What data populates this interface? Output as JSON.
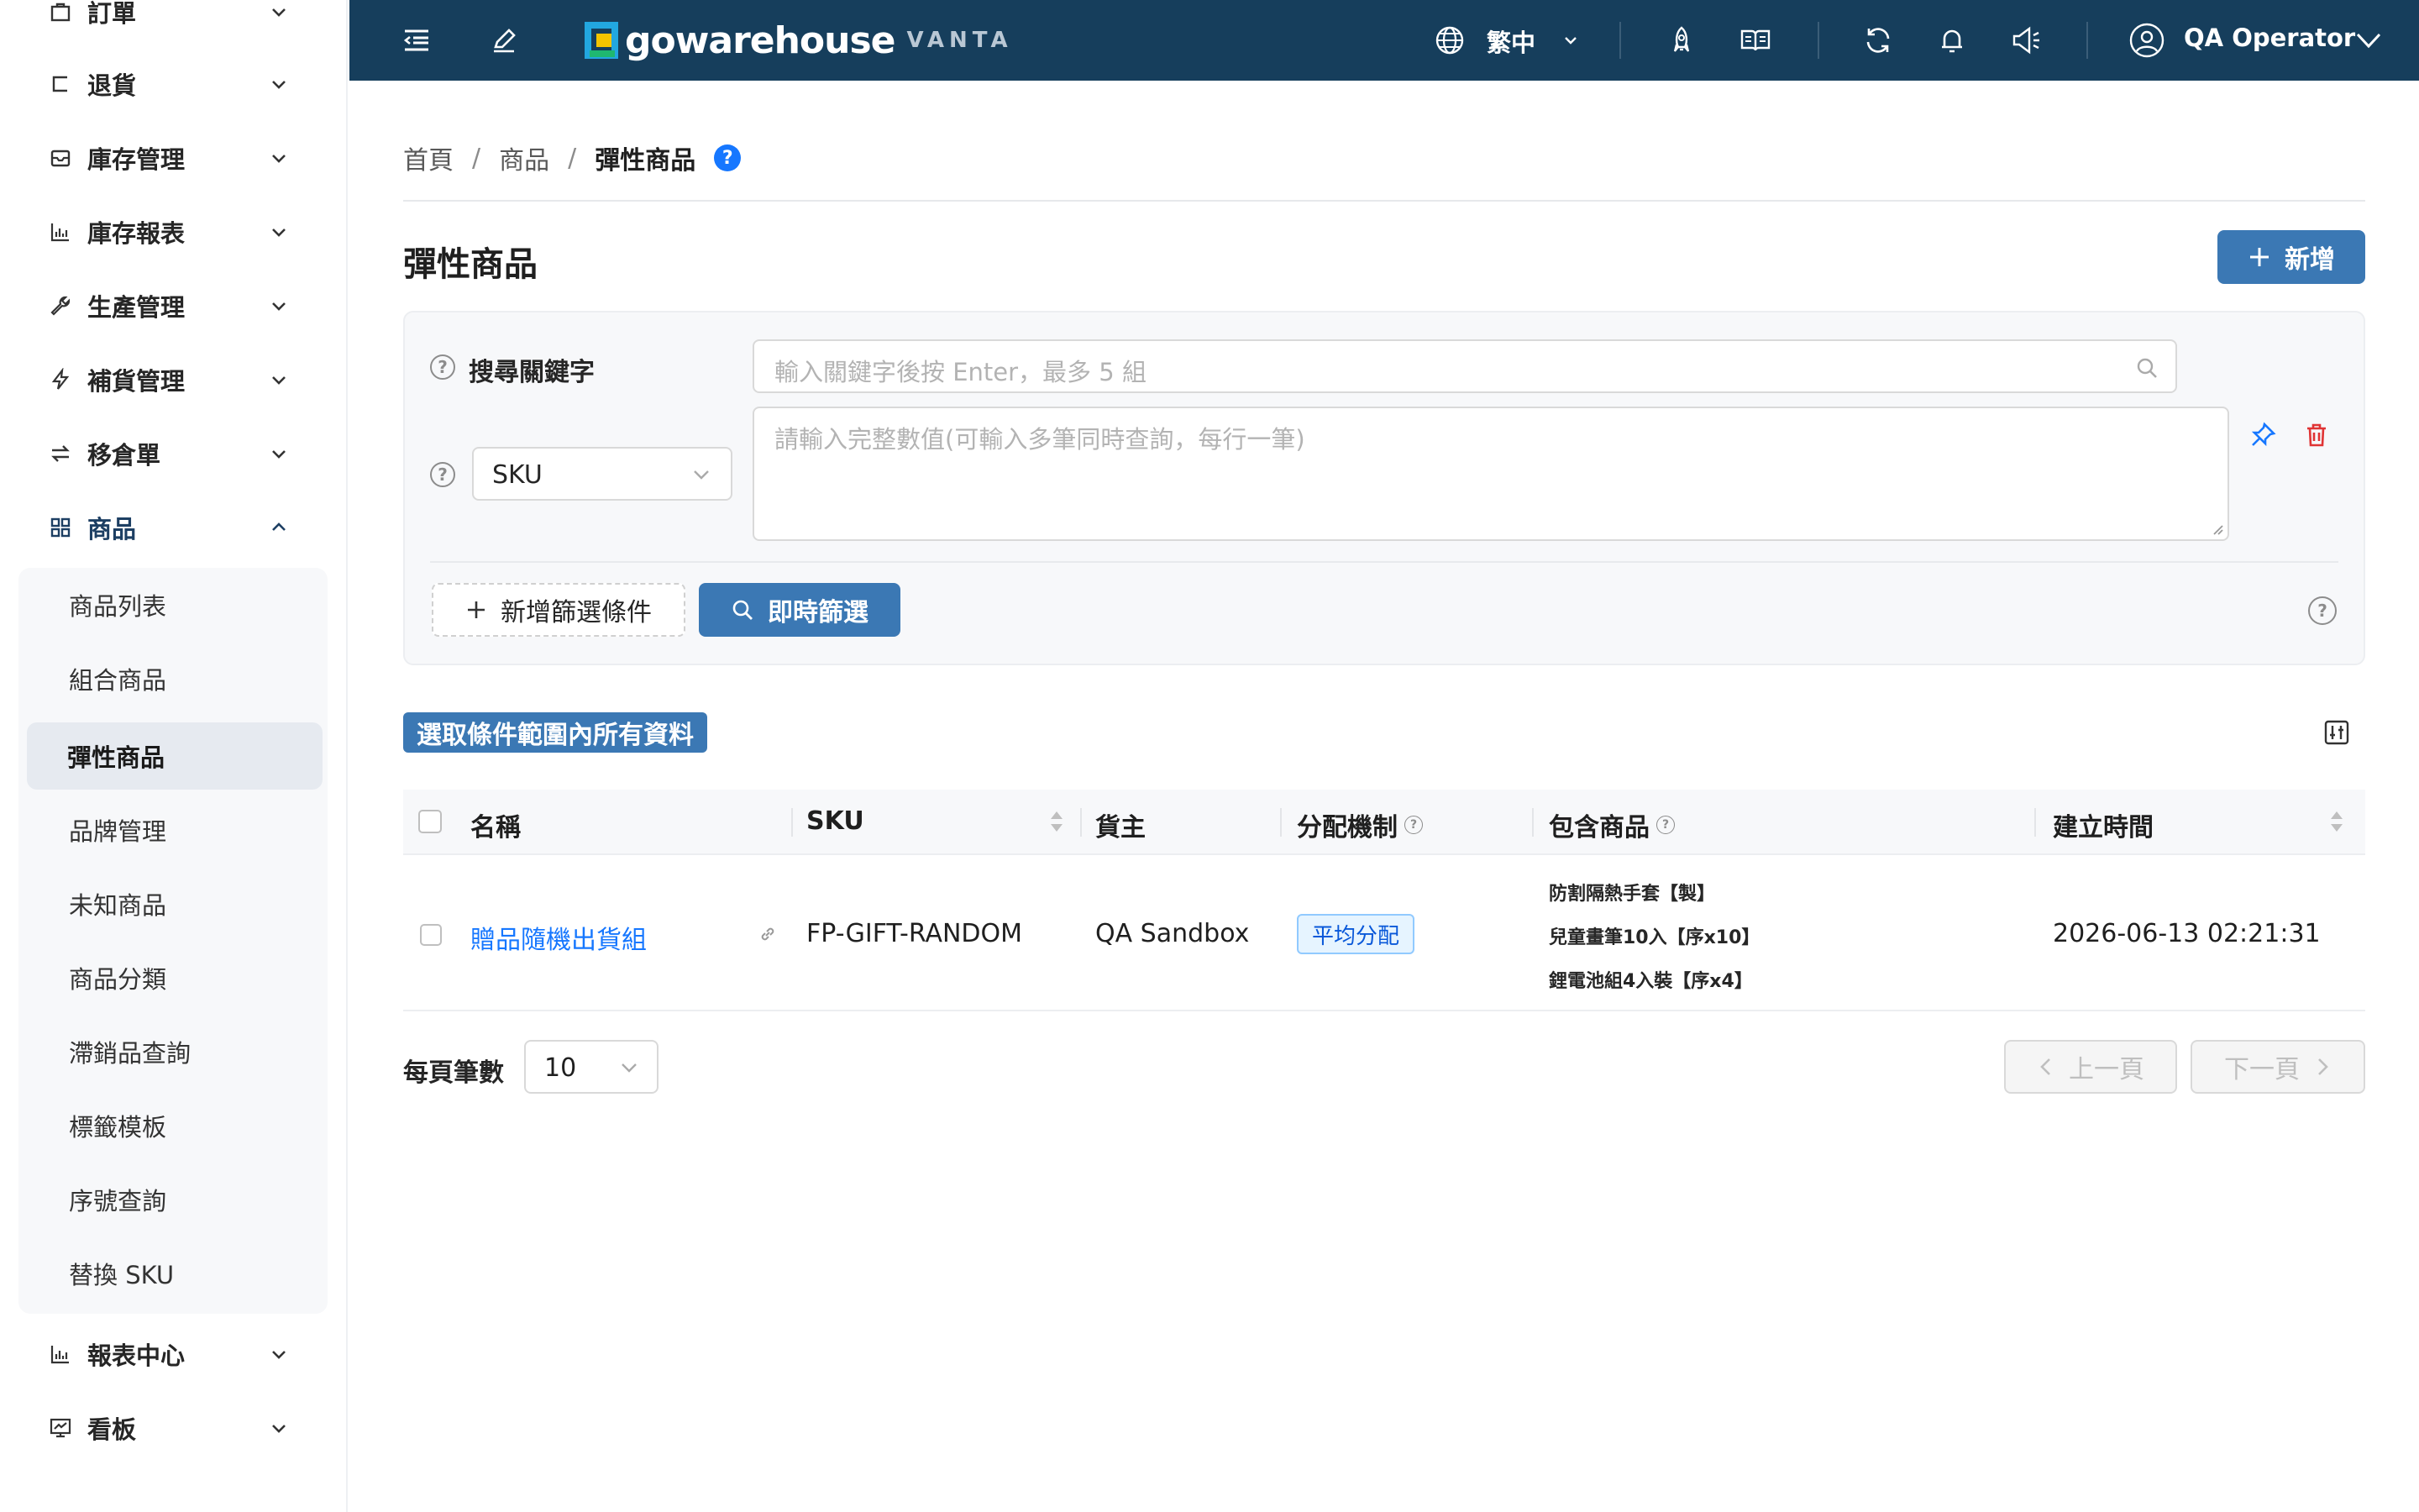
{
  "sidebar": {
    "items": [
      {
        "label": "訂單",
        "icon": "bag-icon"
      },
      {
        "label": "退貨",
        "icon": "return-icon"
      },
      {
        "label": "庫存管理",
        "icon": "inbox-icon"
      },
      {
        "label": "庫存報表",
        "icon": "bar-chart-icon"
      },
      {
        "label": "生產管理",
        "icon": "tool-icon"
      },
      {
        "label": "補貨管理",
        "icon": "thunder-icon"
      },
      {
        "label": "移倉單",
        "icon": "swap-icon"
      },
      {
        "label": "商品",
        "icon": "grid-icon"
      },
      {
        "label": "報表中心",
        "icon": "bar-chart-icon"
      },
      {
        "label": "看板",
        "icon": "dashboard-icon"
      }
    ],
    "submenu": [
      "商品列表",
      "組合商品",
      "彈性商品",
      "品牌管理",
      "未知商品",
      "商品分類",
      "滯銷品查詢",
      "標籤模板",
      "序號查詢",
      "替換 SKU"
    ],
    "selected_submenu": "彈性商品"
  },
  "topbar": {
    "logo_text": "gowarehouse",
    "logo_sub": "VANTA",
    "language": "繁中",
    "user": "QA Operator"
  },
  "breadcrumb": [
    "首頁",
    "商品",
    "彈性商品"
  ],
  "page": {
    "title": "彈性商品",
    "add_button": "新增"
  },
  "filter": {
    "keyword_label": "搜尋關鍵字",
    "keyword_placeholder": "輸入關鍵字後按 Enter，最多 5 組",
    "field_select": "SKU",
    "values_placeholder": "請輸入完整數值(可輸入多筆同時查詢，每行一筆)",
    "add_filter_button": "新增篩選條件",
    "search_button": "即時篩選"
  },
  "select_all_tag": "選取條件範圍內所有資料",
  "table": {
    "columns": [
      "名稱",
      "SKU",
      "貨主",
      "分配機制",
      "包含商品",
      "建立時間"
    ],
    "rows": [
      {
        "name": "贈品隨機出貨組",
        "sku": "FP-GIFT-RANDOM",
        "owner": "QA Sandbox",
        "allocation": "平均分配",
        "included": [
          "防割隔熱手套【製】",
          "兒童畫筆10入【序x10】",
          "鋰電池組4入裝【序x4】"
        ],
        "created": "2026-06-13 02:21:31"
      }
    ]
  },
  "pagination": {
    "per_page_label": "每頁筆數",
    "per_page": "10",
    "prev": "上一頁",
    "next": "下一頁"
  }
}
